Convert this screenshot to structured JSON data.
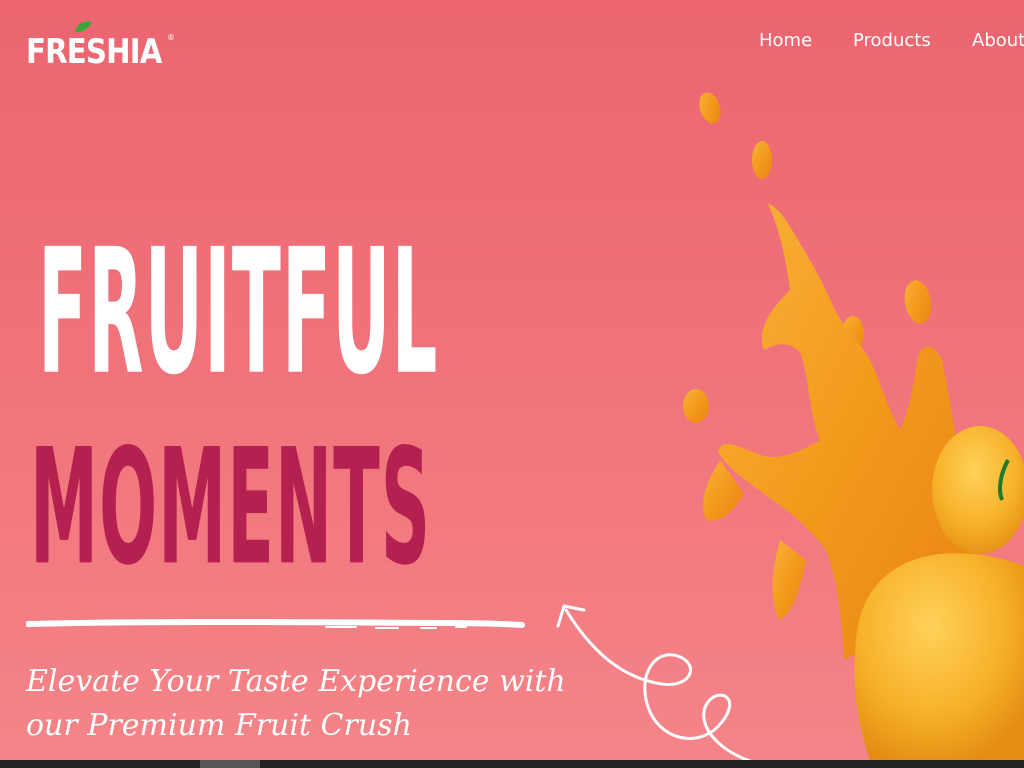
{
  "brand": {
    "logo_text": "FRESHIA",
    "registered_mark": "®",
    "leaf_color": "#3aa63a"
  },
  "nav": {
    "items": [
      {
        "label": "Home"
      },
      {
        "label": "Products"
      },
      {
        "label": "About"
      }
    ]
  },
  "hero": {
    "title_line1": "FRUITFUL",
    "title_line2": "MOMENTS",
    "tagline_line1": "Elevate Your Taste Experience with",
    "tagline_line2": "our Premium Fruit Crush"
  },
  "colors": {
    "background": "#ef6f78",
    "title_primary": "#ffffff",
    "title_accent": "#b42050",
    "juice": "#f5a21c",
    "mango": "#f7b52a"
  },
  "icons": {
    "logo_leaf": "leaf-icon",
    "curly_arrow": "curly-arrow-icon"
  }
}
